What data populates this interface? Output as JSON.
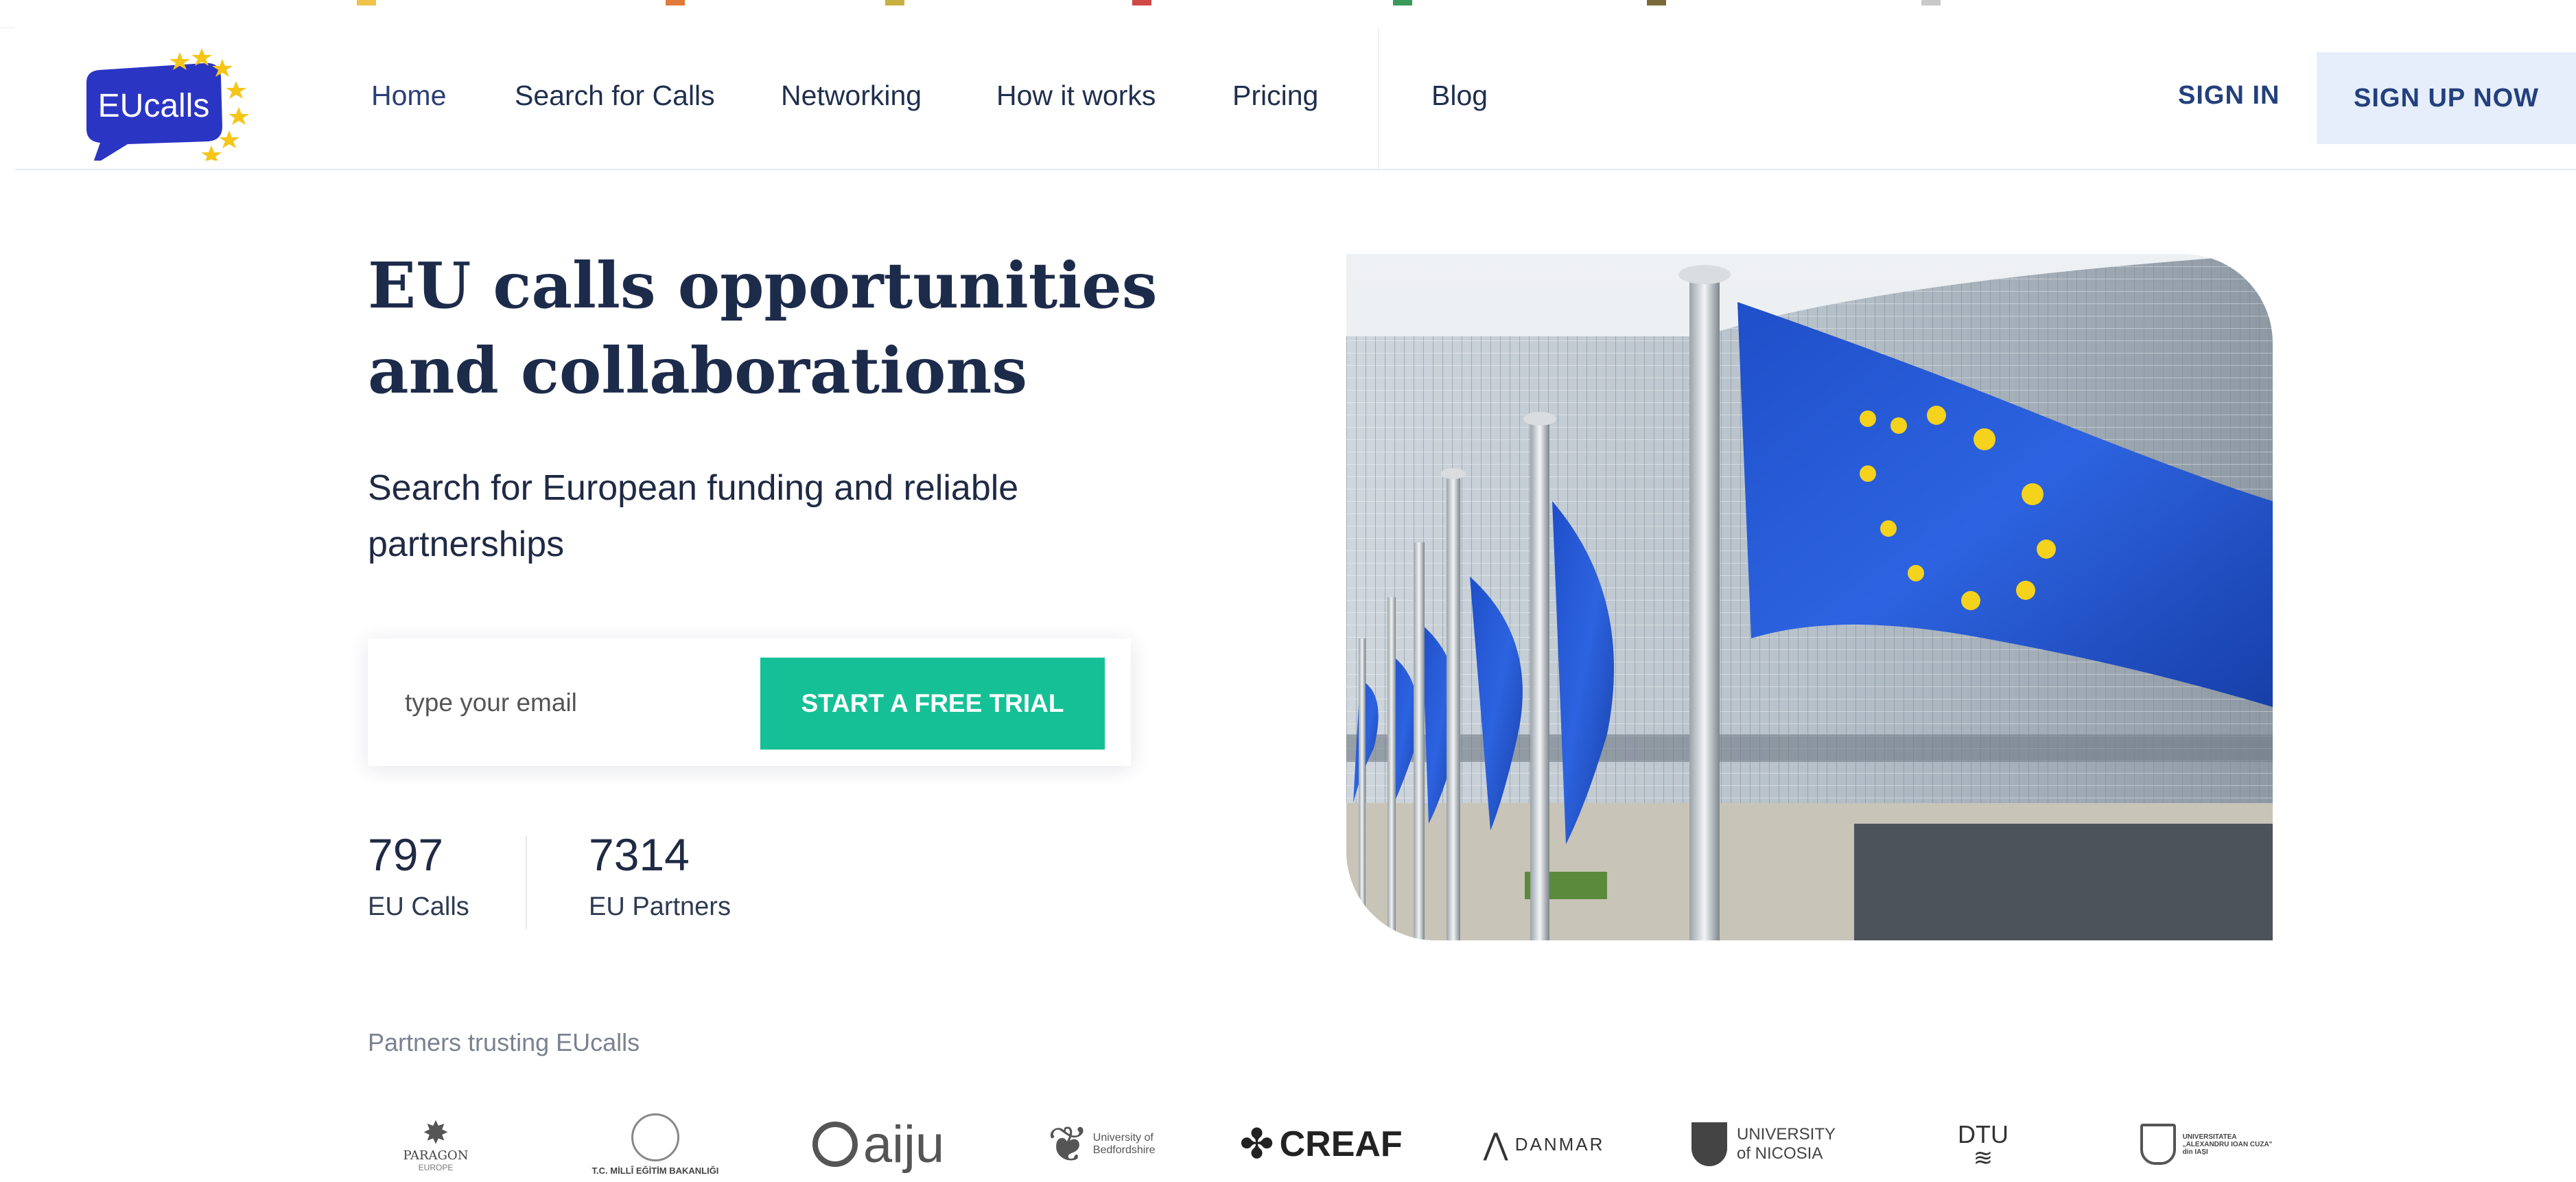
{
  "brand": {
    "logo_text": "EUcalls",
    "accent": "#2b35c4",
    "star": "#f5c518"
  },
  "nav": {
    "items": [
      {
        "label": "Home",
        "active": true
      },
      {
        "label": "Search for Calls"
      },
      {
        "label": "Networking"
      },
      {
        "label": "How it works"
      },
      {
        "label": "Pricing"
      },
      {
        "label": "Blog"
      }
    ],
    "signin": "SIGN IN",
    "signup": "SIGN UP NOW"
  },
  "hero": {
    "title_line1": "EU calls opportunities",
    "title_line2": "and collaborations",
    "subtitle_line1": "Search for European funding and reliable",
    "subtitle_line2": "partnerships",
    "email_placeholder": "type your email",
    "cta": "START A FREE TRIAL",
    "cta_color": "#16c096"
  },
  "stats": [
    {
      "value": "797",
      "label": "EU Calls"
    },
    {
      "value": "7314",
      "label": "EU Partners"
    }
  ],
  "partners": {
    "title": "Partners trusting EUcalls",
    "logos": [
      {
        "name": "paragon-europe-logo",
        "text1": "PARAGON",
        "text2": "EUROPE"
      },
      {
        "name": "tc-milli-egitim-logo",
        "text1": "T.C. MİLLÎ EĞİTİM BAKANLIĞI"
      },
      {
        "name": "aiju-logo",
        "text1": "aiju"
      },
      {
        "name": "university-of-bedfordshire-logo",
        "text1": "University of",
        "text2": "Bedfordshire"
      },
      {
        "name": "creaf-logo",
        "text1": "CREAF"
      },
      {
        "name": "danmar-logo",
        "text1": "DANMAR"
      },
      {
        "name": "university-of-nicosia-logo",
        "text1": "UNIVERSITY",
        "text2": "of NICOSIA"
      },
      {
        "name": "dtu-logo",
        "text1": "DTU"
      },
      {
        "name": "uaic-logo",
        "text1": "UNIVERSITATEA",
        "text2": "„ALEXANDRU IOAN CUZA\"",
        "text3": "din IAȘI"
      }
    ]
  }
}
